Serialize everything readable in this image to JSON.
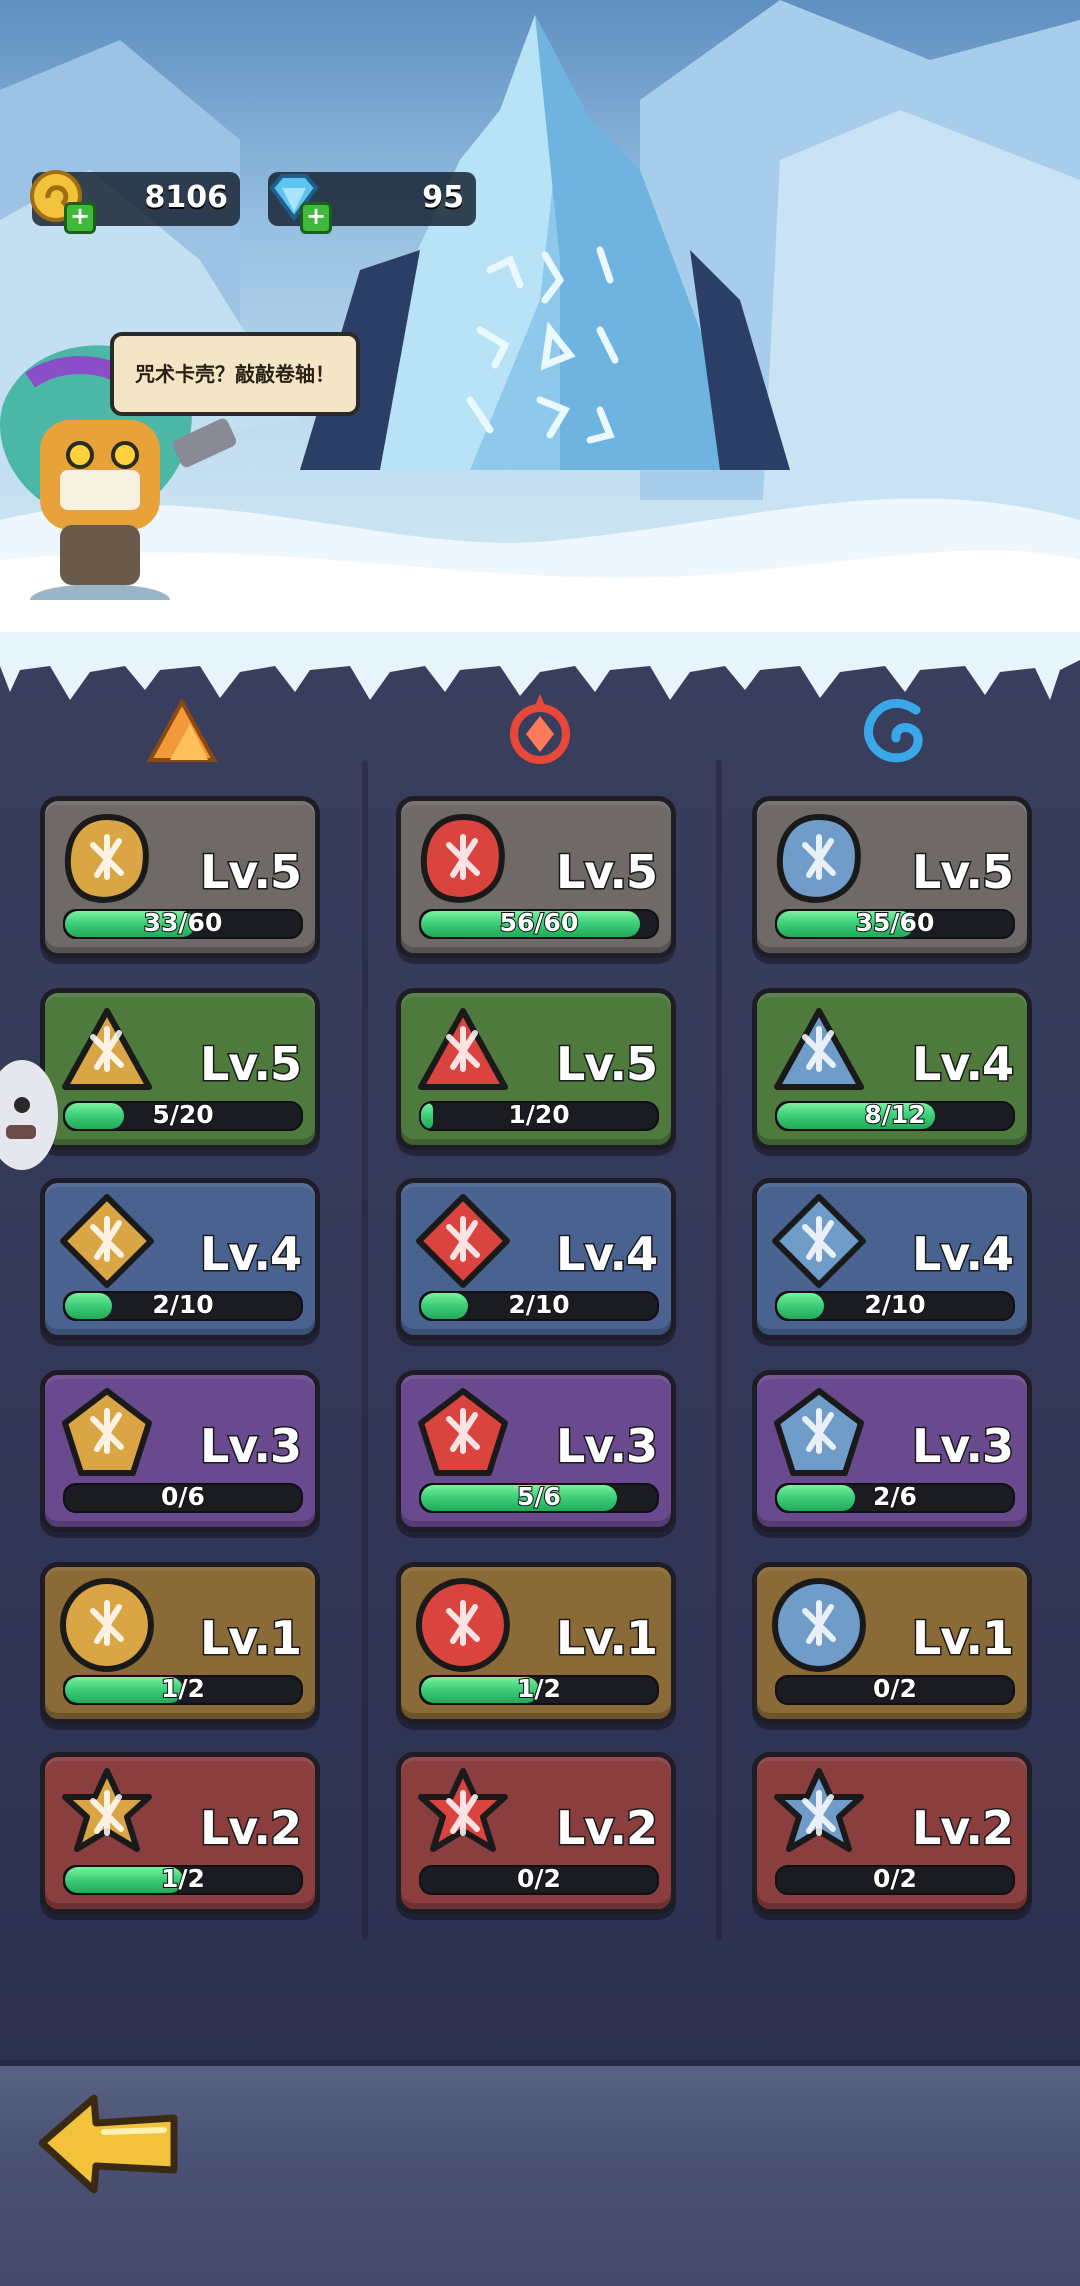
{
  "currencies": {
    "gold": {
      "icon": "gold-coin-icon",
      "amount": "8106"
    },
    "gems": {
      "icon": "diamond-icon",
      "amount": "95"
    }
  },
  "speech_bubble": {
    "text": "咒术卡壳？敲敲卷轴！"
  },
  "columns": [
    {
      "element": "earth",
      "icon": "mountain-icon",
      "color": "#f29a3a"
    },
    {
      "element": "fire",
      "icon": "fire-rune-icon",
      "color": "#e8483a"
    },
    {
      "element": "water",
      "icon": "water-swirl-icon",
      "color": "#3aa8e8"
    }
  ],
  "rows": [
    {
      "theme": "stone",
      "cards": [
        {
          "level": "Lv.5",
          "progress": "33/60",
          "fraction": 0.55,
          "icon": "claw-scroll-icon"
        },
        {
          "level": "Lv.5",
          "progress": "56/60",
          "fraction": 0.93,
          "icon": "flame-scroll-icon"
        },
        {
          "level": "Lv.5",
          "progress": "35/60",
          "fraction": 0.58,
          "icon": "ice-drop-scroll-icon"
        }
      ]
    },
    {
      "theme": "green",
      "cards": [
        {
          "level": "Lv.5",
          "progress": "5/20",
          "fraction": 0.25,
          "icon": "rock-fist-rune-icon"
        },
        {
          "level": "Lv.5",
          "progress": "1/20",
          "fraction": 0.05,
          "icon": "fire-rune-triangle-icon"
        },
        {
          "level": "Lv.4",
          "progress": "8/12",
          "fraction": 0.67,
          "icon": "water-drop-rune-icon"
        }
      ]
    },
    {
      "theme": "blue",
      "cards": [
        {
          "level": "Lv.4",
          "progress": "2/10",
          "fraction": 0.2,
          "icon": "boulder-rune-icon"
        },
        {
          "level": "Lv.4",
          "progress": "2/10",
          "fraction": 0.2,
          "icon": "fire-wave-rune-icon"
        },
        {
          "level": "Lv.4",
          "progress": "2/10",
          "fraction": 0.2,
          "icon": "ice-shard-rune-icon"
        }
      ]
    },
    {
      "theme": "purple",
      "cards": [
        {
          "level": "Lv.3",
          "progress": "0/6",
          "fraction": 0.0,
          "icon": "stone-hand-rune-icon"
        },
        {
          "level": "Lv.3",
          "progress": "5/6",
          "fraction": 0.83,
          "icon": "fire-burst-rune-icon"
        },
        {
          "level": "Lv.3",
          "progress": "2/6",
          "fraction": 0.33,
          "icon": "snowflake-rune-icon"
        }
      ]
    },
    {
      "theme": "gold",
      "cards": [
        {
          "level": "Lv.1",
          "progress": "1/2",
          "fraction": 0.5,
          "icon": "earth-spike-rune-icon"
        },
        {
          "level": "Lv.1",
          "progress": "1/2",
          "fraction": 0.5,
          "icon": "fire-tornado-rune-icon"
        },
        {
          "level": "Lv.1",
          "progress": "0/2",
          "fraction": 0.0,
          "icon": "ice-crystal-rune-icon"
        }
      ]
    },
    {
      "theme": "red",
      "cards": [
        {
          "level": "Lv.2",
          "progress": "1/2",
          "fraction": 0.5,
          "icon": "earth-flame-rune-icon"
        },
        {
          "level": "Lv.2",
          "progress": "0/2",
          "fraction": 0.0,
          "icon": "fire-meteor-rune-icon"
        },
        {
          "level": "Lv.2",
          "progress": "0/2",
          "fraction": 0.0,
          "icon": "water-wave-rune-icon"
        }
      ]
    }
  ],
  "themes": {
    "stone": "#6f6a68",
    "green": "#4e7a3e",
    "blue": "#4a6290",
    "purple": "#6a4a8e",
    "gold": "#8a6a36",
    "red": "#8a3e3e"
  },
  "emblem_colors": {
    "earth": "#d9a545",
    "fire": "#d9443f",
    "water": "#6f9cc9"
  },
  "back_button": {
    "icon": "back-arrow-icon"
  }
}
